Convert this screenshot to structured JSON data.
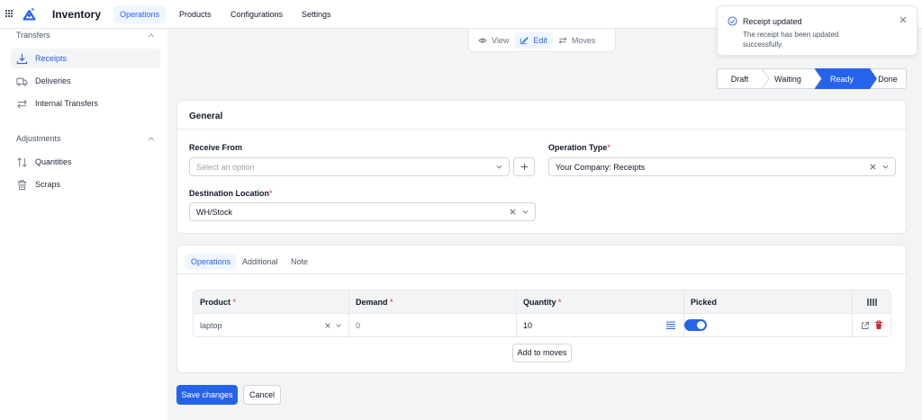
{
  "app": {
    "title": "Inventory"
  },
  "nav": [
    {
      "label": "Operations",
      "active": true
    },
    {
      "label": "Products"
    },
    {
      "label": "Configurations"
    },
    {
      "label": "Settings"
    }
  ],
  "sidebar": {
    "transfers_title": "Transfers",
    "adjustments_title": "Adjustments",
    "items": [
      {
        "label": "Receipts",
        "icon": "receipt-download-icon",
        "active": true
      },
      {
        "label": "Deliveries",
        "icon": "truck-icon"
      },
      {
        "label": "Internal Transfers",
        "icon": "swap-arrows-icon"
      },
      {
        "label": "Quantities",
        "icon": "sort-arrows-icon"
      },
      {
        "label": "Scraps",
        "icon": "trash-icon"
      }
    ]
  },
  "view_switch": {
    "view": "View",
    "edit": "Edit",
    "moves": "Moves",
    "active": "Edit"
  },
  "statusbar": {
    "steps": [
      "Draft",
      "Waiting",
      "Ready",
      "Done"
    ],
    "active": "Ready"
  },
  "general": {
    "title": "General",
    "receive_from": {
      "label": "Receive From",
      "placeholder": "Select an option"
    },
    "operation_type": {
      "label": "Operation Type",
      "value": "Your Company: Receipts"
    },
    "destination": {
      "label": "Destination Location",
      "value": "WH/Stock"
    },
    "required_mark": "*"
  },
  "tabs": [
    "Operations",
    "Additional",
    "Note"
  ],
  "moves_table": {
    "columns": [
      "Product",
      "Demand",
      "Quantity",
      "Picked"
    ],
    "rows": [
      {
        "product": "laptop",
        "demand": "0",
        "quantity": "10",
        "picked": true
      }
    ],
    "add_button": "Add to moves"
  },
  "actions": {
    "save": "Save changes",
    "cancel": "Cancel"
  },
  "toast": {
    "title": "Receipt updated",
    "message": "The receipt has been updated successfully."
  },
  "colors": {
    "accent": "#2563eb",
    "danger": "#dc2626"
  }
}
